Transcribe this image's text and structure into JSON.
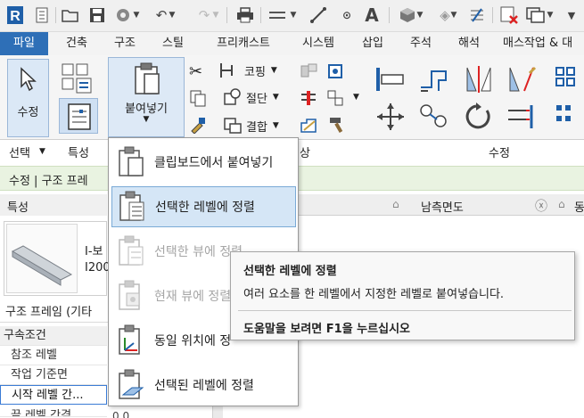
{
  "quick_access": {
    "app_letter": "R",
    "icons": [
      "revit-logo-icon",
      "open-file-icon",
      "save-icon",
      "sync-icon",
      "undo-icon",
      "redo-icon",
      "print-icon",
      "measure-icon",
      "dimension-icon",
      "tag-icon",
      "text-A-icon",
      "3d-view-icon",
      "section-icon",
      "thin-lines-icon",
      "close-hidden-icon",
      "switch-windows-icon",
      "customize-icon"
    ]
  },
  "tabs": [
    {
      "label": "파일",
      "active": true
    },
    {
      "label": "건축",
      "active": false
    },
    {
      "label": "구조",
      "active": false
    },
    {
      "label": "스틸",
      "active": false
    },
    {
      "label": "프리캐스트",
      "active": false
    },
    {
      "label": "시스템",
      "active": false
    },
    {
      "label": "삽입",
      "active": false
    },
    {
      "label": "주석",
      "active": false
    },
    {
      "label": "해석",
      "active": false
    },
    {
      "label": "매스작업 & 대",
      "active": false
    }
  ],
  "ribbon": {
    "modify_label": "수정",
    "paste_label": "붙여넣기",
    "cope_label": "코핑",
    "cut_label": "절단",
    "join_label": "결합",
    "panels": {
      "select": "선택",
      "properties": "특성",
      "modify": "수정",
      "geometry_suffix": "상"
    }
  },
  "context_bar": {
    "text": "수정 | 구조 프레"
  },
  "properties": {
    "header": "특성",
    "type_name_1": "I-보",
    "type_name_2": "I200",
    "family_selector": "구조 프레임 (기타",
    "section_title": "구속조건",
    "rows": [
      "참조 레벨",
      "작업 기준면",
      "시작 레벨 간..."
    ],
    "partial_row": "끝 레벨 간격",
    "partial_value": "0.0"
  },
  "view_tabs": {
    "view_name": "남측면도",
    "view_name_2": "동측"
  },
  "paste_menu": {
    "items": [
      {
        "label": "클립보드에서 붙여넣기",
        "enabled": true,
        "highlighted": false
      },
      {
        "label": "선택한 레벨에 정렬",
        "enabled": true,
        "highlighted": true
      },
      {
        "label": "선택한 뷰에 정렬",
        "enabled": false,
        "highlighted": false
      },
      {
        "label": "현재 뷰에 정렬",
        "enabled": false,
        "highlighted": false
      },
      {
        "label": "동일 위치에 정",
        "enabled": true,
        "highlighted": false
      },
      {
        "label": "선택된 레벨에 정렬",
        "enabled": true,
        "highlighted": false
      }
    ]
  },
  "tooltip": {
    "title": "선택한 레벨에 정렬",
    "description": "여러 요소를 한 레벨에서 지정한 레벨로 붙여넣습니다.",
    "help": "도움말을 보려면 F1을 누르십시오"
  },
  "colors": {
    "accent": "#2e6fb7",
    "highlight": "#d5e6f6",
    "context": "#e9f3e1"
  }
}
